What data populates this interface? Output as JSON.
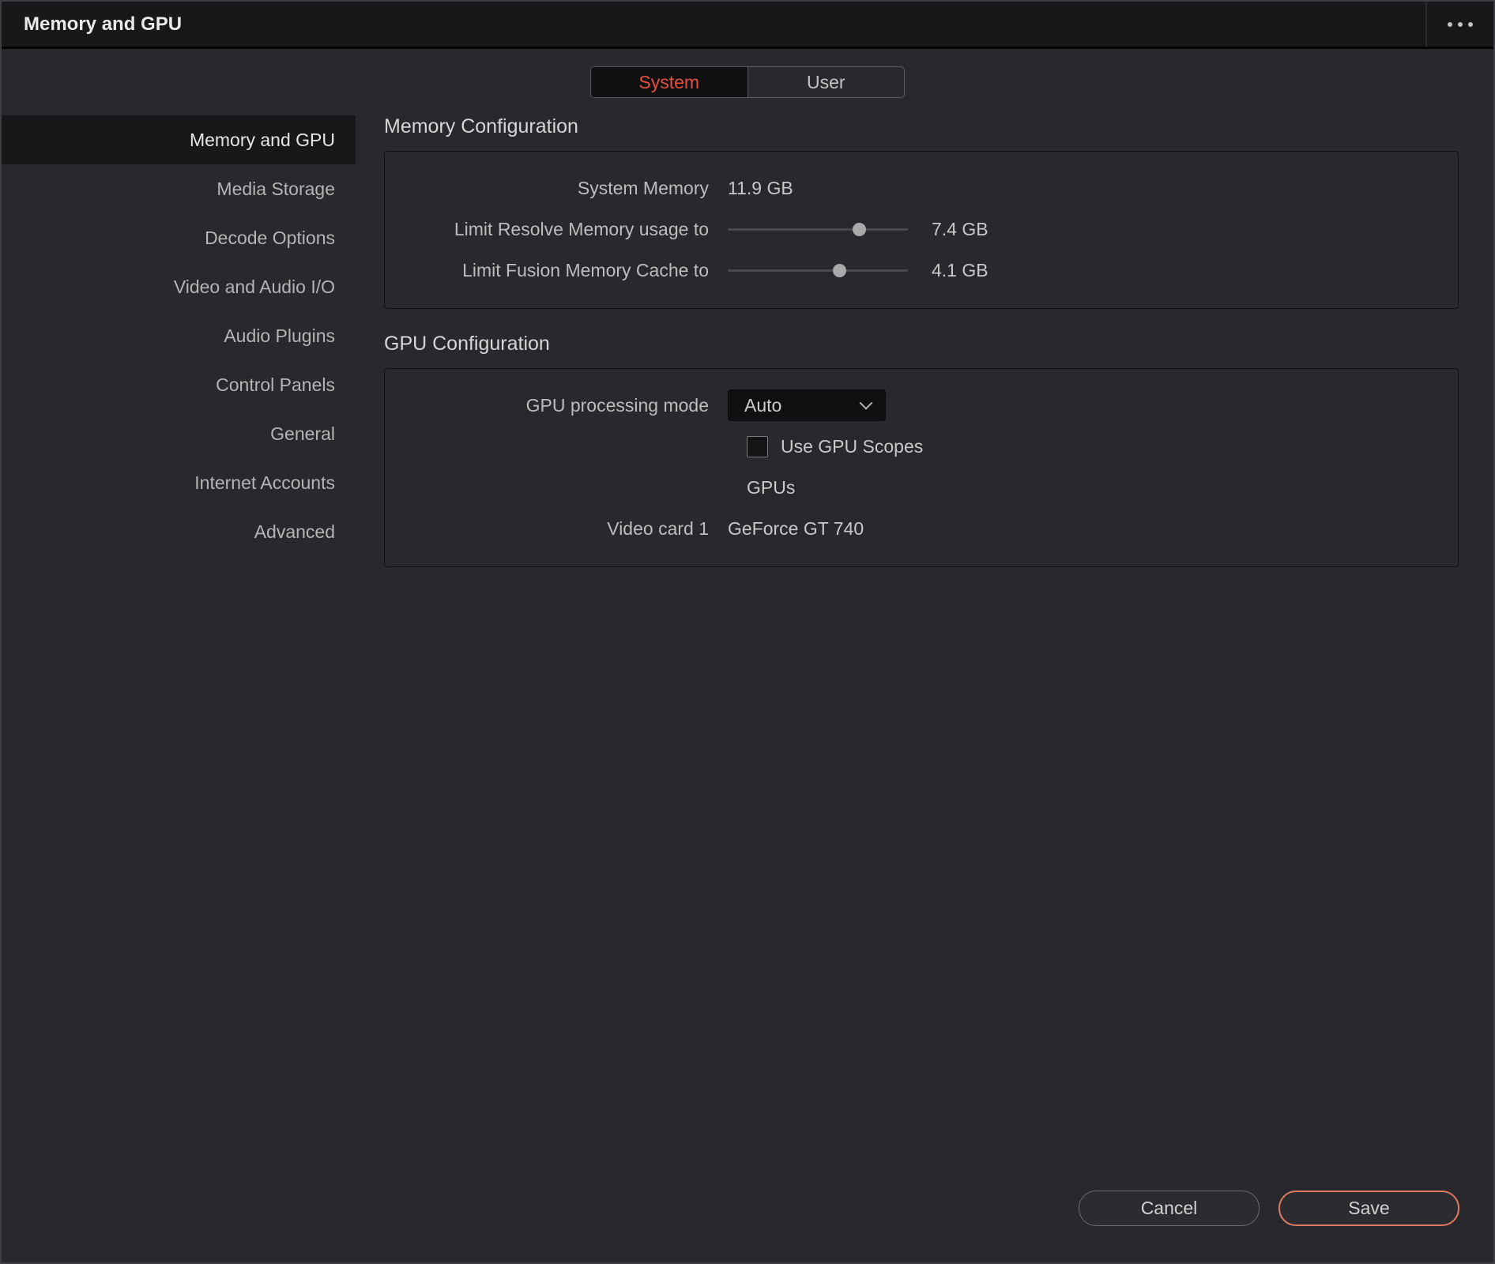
{
  "window": {
    "title": "Memory and GPU"
  },
  "tabs": {
    "system": "System",
    "user": "User"
  },
  "sidebar": {
    "items": [
      {
        "label": "Memory and GPU",
        "selected": true
      },
      {
        "label": "Media Storage",
        "selected": false
      },
      {
        "label": "Decode Options",
        "selected": false
      },
      {
        "label": "Video and Audio I/O",
        "selected": false
      },
      {
        "label": "Audio Plugins",
        "selected": false
      },
      {
        "label": "Control Panels",
        "selected": false
      },
      {
        "label": "General",
        "selected": false
      },
      {
        "label": "Internet Accounts",
        "selected": false
      },
      {
        "label": "Advanced",
        "selected": false
      }
    ]
  },
  "memory": {
    "section_title": "Memory Configuration",
    "system_memory": {
      "label": "System Memory",
      "value": "11.9 GB"
    },
    "resolve_limit": {
      "label": "Limit Resolve Memory usage to",
      "value": "7.4 GB",
      "slider_percent": 73
    },
    "fusion_limit": {
      "label": "Limit Fusion Memory Cache to",
      "value": "4.1 GB",
      "slider_percent": 62
    }
  },
  "gpu": {
    "section_title": "GPU Configuration",
    "processing_mode": {
      "label": "GPU processing mode",
      "value": "Auto"
    },
    "scopes": {
      "label": "Use GPU Scopes",
      "checked": false
    },
    "gpus_label": "GPUs",
    "video_card": {
      "label": "Video card 1",
      "value": "GeForce GT 740"
    }
  },
  "footer": {
    "cancel_label": "Cancel",
    "save_label": "Save"
  },
  "colors": {
    "accent_red": "#e5503c",
    "save_border": "#df7a60"
  }
}
